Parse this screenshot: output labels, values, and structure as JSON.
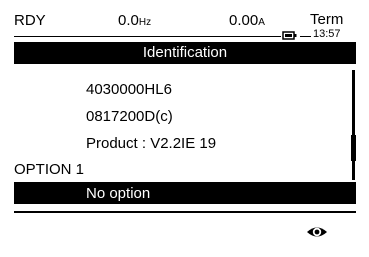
{
  "status": {
    "state": "RDY",
    "frequency_value": "0.0",
    "frequency_unit": "Hz",
    "current_value": "0.00",
    "current_unit": "A",
    "mode": "Term",
    "time": "13:57"
  },
  "title": "Identification",
  "lines": [
    "4030000HL6",
    "0817200D(c)",
    "Product : V2.2IE 19"
  ],
  "option_header": "OPTION 1",
  "option_selected": "No option",
  "icons": {
    "view": "eye-icon",
    "battery": "battery-icon"
  },
  "colors": {
    "foreground": "#000000",
    "background": "#ffffff"
  }
}
